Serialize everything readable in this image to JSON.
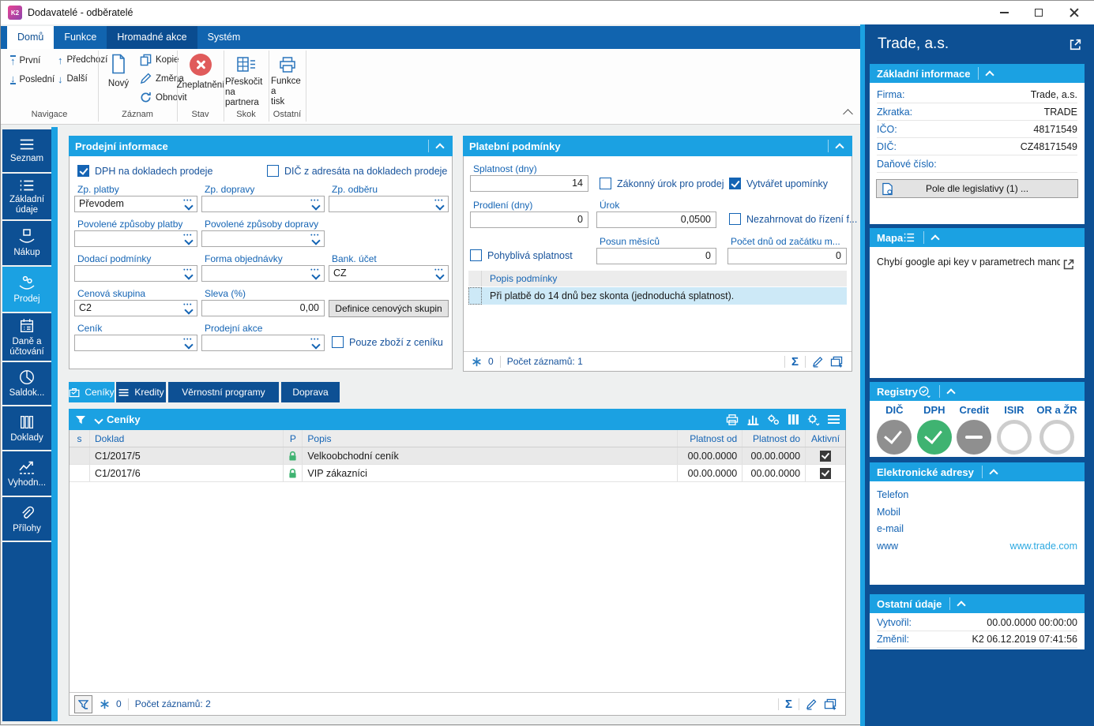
{
  "colors": {
    "accent": "#1ba1e2",
    "dark_blue": "#0d5094",
    "ribbon_blue": "#1164af",
    "green": "#3fb371",
    "red": "#e05b5b",
    "link": "#2da9e1",
    "label_blue": "#1464b4"
  },
  "window": {
    "title": "Dodavatelé - odběratelé",
    "logo": "K2"
  },
  "ribbon": {
    "tabs": [
      {
        "label": "Domů"
      },
      {
        "label": "Funkce"
      },
      {
        "label": "Hromadné akce"
      },
      {
        "label": "Systém"
      }
    ],
    "navigace": {
      "prvni": "První",
      "posledni": "Poslední",
      "predchozi": "Předchozí",
      "dalsi": "Další",
      "group": "Navigace"
    },
    "zaznam": {
      "novy": "Nový",
      "kopie": "Kopie",
      "zmena": "Změna",
      "obnovit": "Obnovit",
      "group": "Záznam"
    },
    "stav": {
      "zneplatneni": "Zneplatnění",
      "group": "Stav"
    },
    "skok": {
      "preskocit_l1": "Přeskočit",
      "preskocit_l2": "na partnera",
      "group": "Skok"
    },
    "ostatni": {
      "funkce_l1": "Funkce a",
      "funkce_l2": "tisk",
      "group": "Ostatní"
    }
  },
  "sidebar": {
    "items": [
      {
        "label": "Seznam"
      },
      {
        "label": "Základní údaje"
      },
      {
        "label": "Nákup"
      },
      {
        "label": "Prodej"
      },
      {
        "label": "Daně a účtování"
      },
      {
        "label": "Saldok..."
      },
      {
        "label": "Doklady"
      },
      {
        "label": "Vyhodn..."
      },
      {
        "label": "Přílohy"
      }
    ]
  },
  "prodejni": {
    "title": "Prodejní informace",
    "cb_dph": "DPH na dokladech prodeje",
    "cb_dic": "DIČ z adresáta na dokladech prodeje",
    "fields": {
      "zp_platby": {
        "label": "Zp. platby",
        "value": "Převodem"
      },
      "zp_dopravy": {
        "label": "Zp. dopravy",
        "value": ""
      },
      "zp_odberu": {
        "label": "Zp. odběru",
        "value": ""
      },
      "pov_platby": {
        "label": "Povolené způsoby platby",
        "value": ""
      },
      "pov_dopravy": {
        "label": "Povolené způsoby dopravy",
        "value": ""
      },
      "dodaci": {
        "label": "Dodací podmínky",
        "value": ""
      },
      "forma": {
        "label": "Forma objednávky",
        "value": ""
      },
      "bank": {
        "label": "Bank. účet",
        "value": "CZ"
      },
      "cenova": {
        "label": "Cenová skupina",
        "value": "C2"
      },
      "sleva": {
        "label": "Sleva (%)",
        "value": "0,00"
      },
      "cenik": {
        "label": "Ceník",
        "value": ""
      },
      "akce": {
        "label": "Prodejní akce",
        "value": ""
      }
    },
    "btn_definice": "Definice cenových skupin",
    "cb_pouze": "Pouze zboží z ceníku"
  },
  "platebni": {
    "title": "Platební podmínky",
    "fields": {
      "splatnost": {
        "label": "Splatnost (dny)",
        "value": "14"
      },
      "prodleni": {
        "label": "Prodlení (dny)",
        "value": "0"
      },
      "urok": {
        "label": "Úrok",
        "value": "0,0500"
      },
      "posun": {
        "label": "Posun měsíců",
        "value": "0"
      },
      "pocet_dnu": {
        "label": "Počet dnů od začátku m...",
        "value": "0"
      }
    },
    "cb_zakonny": "Zákonný úrok pro prodej",
    "cb_upominky": "Vytvářet upomínky",
    "cb_nezahrnovat": "Nezahrnovat do řízení f...",
    "cb_pohybliva": "Pohyblivá splatnost",
    "grid_header": "Popis podmínky",
    "grid_row": "Při platbě do 14 dnů bez skonta (jednoduchá splatnost).",
    "badge": "0",
    "records": "Počet záznamů: 1"
  },
  "detail_tabs": [
    {
      "label": "Ceníky"
    },
    {
      "label": "Kredity"
    },
    {
      "label": "Věrnostní programy"
    },
    {
      "label": "Doprava"
    }
  ],
  "ceniky": {
    "title": "Ceníky",
    "columns": {
      "s": "s",
      "doklad": "Doklad",
      "p": "P",
      "popis": "Popis",
      "od": "Platnost od",
      "do": "Platnost do",
      "aktivni": "Aktivní"
    },
    "rows": [
      {
        "doklad": "C1/2017/5",
        "popis": "Velkoobchodní ceník",
        "od": "00.00.0000",
        "do": "00.00.0000"
      },
      {
        "doklad": "C1/2017/6",
        "popis": "VIP zákazníci",
        "od": "00.00.0000",
        "do": "00.00.0000"
      }
    ],
    "badge": "0",
    "records": "Počet záznamů: 2"
  },
  "right": {
    "company": "Trade, a.s.",
    "zakladni": {
      "title": "Základní informace",
      "rows": [
        {
          "label": "Firma:",
          "value": "Trade, a.s."
        },
        {
          "label": "Zkratka:",
          "value": "TRADE"
        },
        {
          "label": "IČO:",
          "value": "48171549"
        },
        {
          "label": "DIČ:",
          "value": "CZ48171549"
        },
        {
          "label": "Daňové číslo:",
          "value": ""
        }
      ],
      "button": "Pole dle legislativy (1) ..."
    },
    "mapa": {
      "title": "Mapa",
      "message": "Chybí google api key v parametrech manda"
    },
    "registry": {
      "title": "Registry",
      "items": [
        {
          "label": "DIČ",
          "state": "gray-check"
        },
        {
          "label": "DPH",
          "state": "green-check"
        },
        {
          "label": "Credit",
          "state": "gray-dash"
        },
        {
          "label": "ISIR",
          "state": "empty"
        },
        {
          "label": "OR a ŽR",
          "state": "empty"
        }
      ]
    },
    "adresy": {
      "title": "Elektronické adresy",
      "rows": [
        {
          "label": "Telefon",
          "value": ""
        },
        {
          "label": "Mobil",
          "value": ""
        },
        {
          "label": "e-mail",
          "value": ""
        },
        {
          "label": "www",
          "value": "www.trade.com"
        }
      ]
    },
    "ostatni": {
      "title": "Ostatní údaje",
      "rows": [
        {
          "label": "Vytvořil:",
          "value": "00.00.0000 00:00:00"
        },
        {
          "label": "Změnil:",
          "value": "K2 06.12.2019 07:41:56"
        }
      ]
    }
  }
}
